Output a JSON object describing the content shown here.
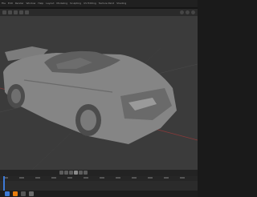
{
  "app": {
    "accent": "#3d7ad6",
    "viewport_bg": "#3b3b3b",
    "model_color": "#8a8a8a"
  },
  "menu": {
    "items": [
      "File",
      "Edit",
      "Render",
      "Window",
      "Help",
      "Layout",
      "Modeling",
      "Sculpting",
      "UV Editing",
      "Texture Paint",
      "Shading"
    ]
  },
  "header": {
    "icons": [
      "editor-type-icon",
      "view-icon",
      "select-icon",
      "add-icon",
      "object-icon"
    ]
  },
  "viewport": {
    "object": "race-car-model"
  },
  "timeline": {
    "controls": [
      "jump-start-icon",
      "prev-key-icon",
      "play-reverse-icon",
      "play-icon",
      "next-key-icon",
      "jump-end-icon"
    ]
  },
  "status": {
    "tray_icons": [
      "start-icon",
      "blender-icon",
      "app-icon",
      "app-icon-2"
    ]
  }
}
